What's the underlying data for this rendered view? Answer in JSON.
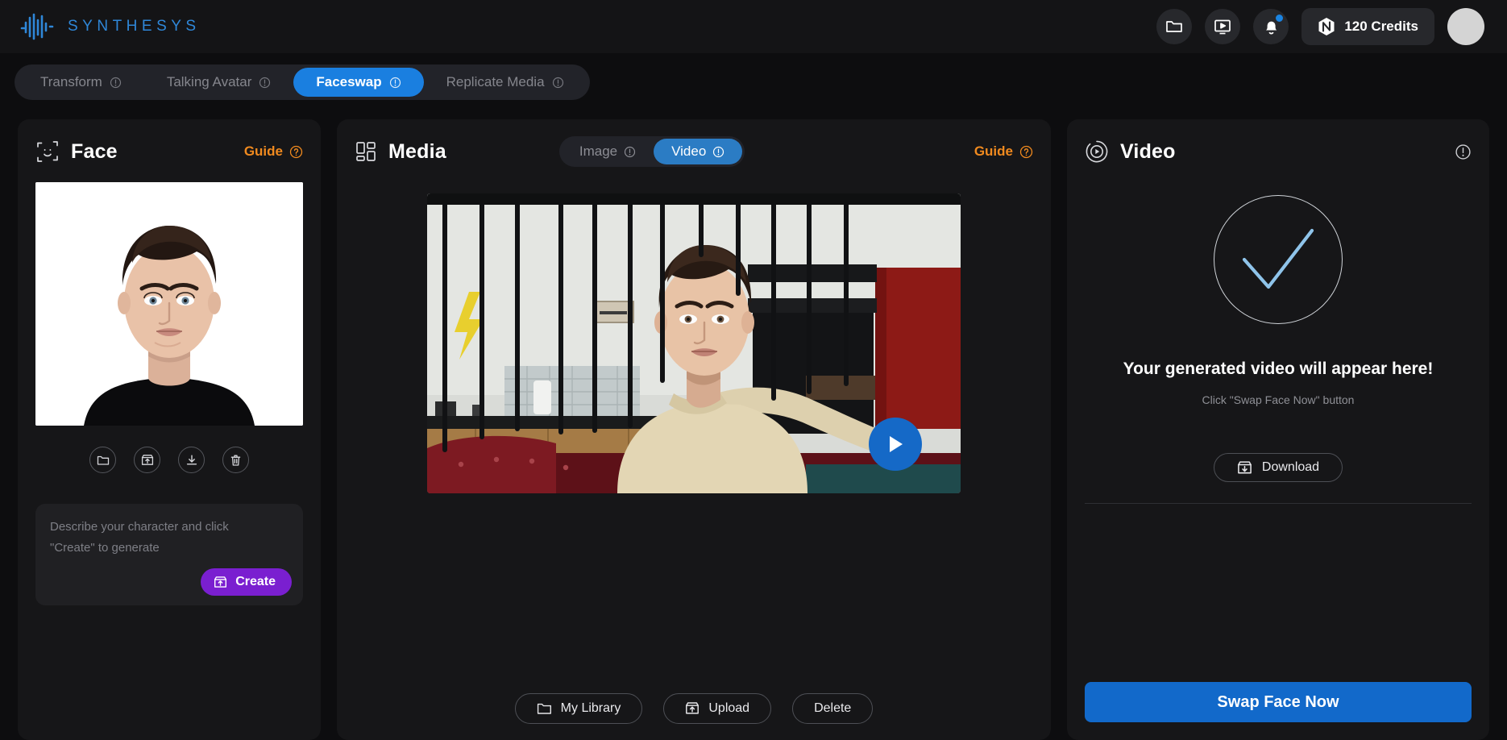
{
  "app": {
    "brand_name": "SYNTHESYS",
    "brand_icon": "waveform-logo"
  },
  "topbar": {
    "folder_icon": "folder-icon",
    "media_icon": "video-player-icon",
    "notifications_icon": "bell-icon",
    "credits_label": "120 Credits",
    "credits_icon": "nexus-token-icon",
    "avatar": "user-avatar"
  },
  "tabs": [
    {
      "label": "Transform",
      "active": false,
      "info_icon": "info-icon"
    },
    {
      "label": "Talking Avatar",
      "active": false,
      "info_icon": "info-icon"
    },
    {
      "label": "Faceswap",
      "active": true,
      "info_icon": "info-icon"
    },
    {
      "label": "Replicate Media",
      "active": false,
      "info_icon": "info-icon"
    }
  ],
  "face_panel": {
    "icon": "face-scan-icon",
    "title": "Face",
    "guide_label": "Guide",
    "guide_icon": "question-circle-icon",
    "image_alt": "portrait-headshot-man-dark-hair-black-shirt",
    "actions": [
      {
        "name": "my-library",
        "icon": "folder-icon"
      },
      {
        "name": "upload",
        "icon": "upload-box-icon"
      },
      {
        "name": "download",
        "icon": "download-icon"
      },
      {
        "name": "delete",
        "icon": "trash-icon"
      }
    ],
    "prompt_placeholder": "Describe your character and click \"Create\" to generate",
    "prompt_value": "",
    "create_label": "Create",
    "create_icon": "upload-box-icon"
  },
  "media_panel": {
    "icon": "layout-grid-icon",
    "title": "Media",
    "toggle": [
      {
        "label": "Image",
        "active": false,
        "info_icon": "info-icon"
      },
      {
        "label": "Video",
        "active": true,
        "info_icon": "info-icon"
      }
    ],
    "guide_label": "Guide",
    "guide_icon": "question-circle-icon",
    "preview_alt": "young-man-on-red-leather-sofa-in-loft-kitchen",
    "play_icon": "play-icon",
    "footer_buttons": [
      {
        "label": "My Library",
        "icon": "folder-icon"
      },
      {
        "label": "Upload",
        "icon": "upload-box-icon"
      },
      {
        "label": "Delete",
        "icon": ""
      }
    ]
  },
  "video_panel": {
    "icon": "play-circle-icon",
    "title": "Video",
    "info_icon": "info-icon",
    "check_icon": "checkmark-icon",
    "empty_title": "Your generated video will appear here!",
    "empty_subtitle": "Click \"Swap Face Now\" button",
    "download_label": "Download",
    "download_icon": "download-box-icon",
    "swap_label": "Swap Face Now"
  },
  "colors": {
    "page_bg": "#0d0d0f",
    "panel_bg": "#161618",
    "accent_blue": "#1a7fe0",
    "guide_orange": "#f08a1f",
    "create_purple": "#7a1fd0",
    "brand_blue": "#2f87d8",
    "check_blue": "#8fc4ea"
  }
}
